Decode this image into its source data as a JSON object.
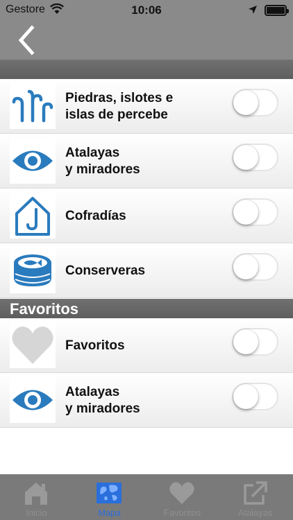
{
  "status_bar": {
    "carrier": "Gestore",
    "time": "10:06"
  },
  "nav": {
    "back_icon": "chevron-left-icon"
  },
  "rows_top": [
    {
      "icon": "rocks-icon",
      "label_line1": "Piedras, islotes e",
      "label_line2": "islas de percebe",
      "enabled": false
    },
    {
      "icon": "eye-icon",
      "label_line1": "Atalayas",
      "label_line2": "y miradores",
      "enabled": false
    },
    {
      "icon": "house-hook-icon",
      "label_line1": "Cofradías",
      "label_line2": "",
      "enabled": false
    },
    {
      "icon": "fish-can-icon",
      "label_line1": "Conserveras",
      "label_line2": "",
      "enabled": false
    }
  ],
  "favorites_section": {
    "title": "Favoritos"
  },
  "rows_fav": [
    {
      "icon": "heart-icon",
      "label_line1": "Favoritos",
      "label_line2": "",
      "enabled": false
    },
    {
      "icon": "eye-icon",
      "label_line1": "Atalayas",
      "label_line2": "y miradores",
      "enabled": false
    }
  ],
  "tabs": [
    {
      "icon": "home-icon",
      "label": "Inicio",
      "active": false
    },
    {
      "icon": "map-icon",
      "label": "Mapa",
      "active": true
    },
    {
      "icon": "heart-icon",
      "label": "Favoritos",
      "active": false
    },
    {
      "icon": "external-link-icon",
      "label": "Atalayas",
      "active": false
    }
  ],
  "colors": {
    "accent_blue": "#2a7bbd",
    "tab_active": "#2a6fdb",
    "header_gray": "#8a8a8a"
  }
}
